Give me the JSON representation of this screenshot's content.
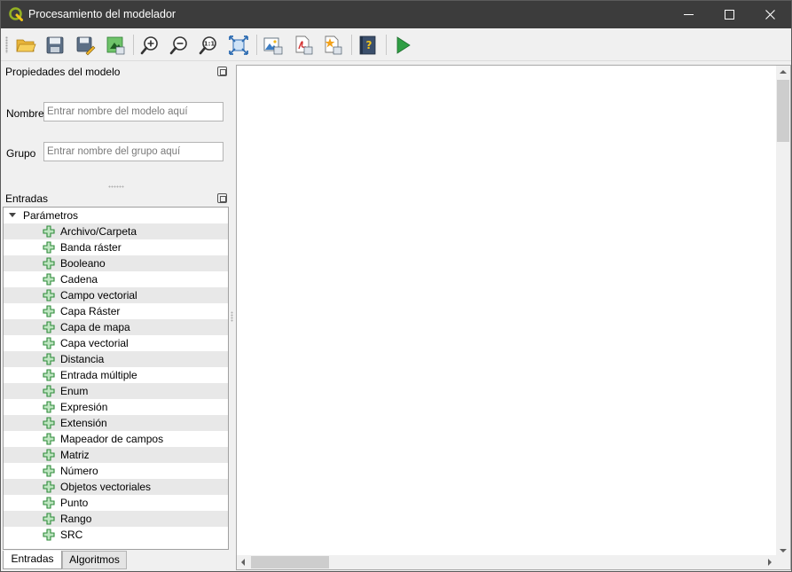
{
  "window": {
    "title": "Procesamiento del modelador"
  },
  "toolbar": {
    "buttons": [
      {
        "name": "open-model-button",
        "icon": "folder-open-icon"
      },
      {
        "name": "save-model-button",
        "icon": "save-icon"
      },
      {
        "name": "save-as-button",
        "icon": "save-as-icon"
      },
      {
        "name": "save-to-project-button",
        "icon": "save-to-project-icon"
      },
      {
        "name": "zoom-in-button",
        "icon": "zoom-in-icon"
      },
      {
        "name": "zoom-out-button",
        "icon": "zoom-out-icon"
      },
      {
        "name": "zoom-actual-button",
        "icon": "zoom-actual-icon"
      },
      {
        "name": "zoom-full-button",
        "icon": "zoom-full-icon"
      },
      {
        "name": "export-image-button",
        "icon": "export-image-icon"
      },
      {
        "name": "export-pdf-button",
        "icon": "export-pdf-icon"
      },
      {
        "name": "export-svg-button",
        "icon": "export-svg-icon"
      },
      {
        "name": "help-button",
        "icon": "help-book-icon"
      },
      {
        "name": "run-model-button",
        "icon": "run-play-icon"
      }
    ]
  },
  "properties": {
    "title": "Propiedades del modelo",
    "name_label": "Nombre",
    "name_placeholder": "Entrar nombre del modelo aquí",
    "group_label": "Grupo",
    "group_placeholder": "Entrar nombre del grupo aquí"
  },
  "inputs": {
    "title": "Entradas",
    "root": "Parámetros",
    "items": [
      "Archivo/Carpeta",
      "Banda ráster",
      "Booleano",
      "Cadena",
      "Campo vectorial",
      "Capa Ráster",
      "Capa de mapa",
      "Capa vectorial",
      "Distancia",
      "Entrada múltiple",
      "Enum",
      "Expresión",
      "Extensión",
      "Mapeador de campos",
      "Matriz",
      "Número",
      "Objetos vectoriales",
      "Punto",
      "Rango",
      "SRC"
    ]
  },
  "tabs": [
    "Entradas",
    "Algoritmos"
  ],
  "colors": {
    "titlebar": "#3c3c3c",
    "plus_green": "#2e8b3a",
    "run_green": "#2f9e44"
  }
}
